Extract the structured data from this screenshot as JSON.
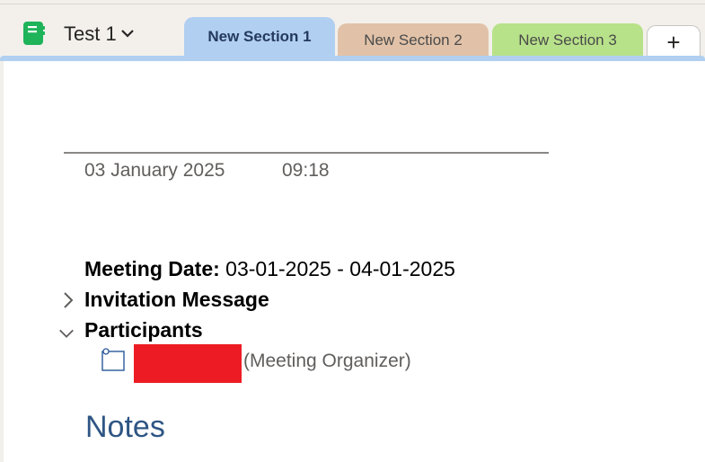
{
  "notebook": {
    "name": "Test 1",
    "icon": "notebook-icon",
    "icon_color": "#1fb35a"
  },
  "tabs": [
    {
      "label": "New Section 1",
      "color": "#b1cff0",
      "active": true
    },
    {
      "label": "New Section 2",
      "color": "#e1c2a8",
      "active": false
    },
    {
      "label": "New Section 3",
      "color": "#b8e28a",
      "active": false
    }
  ],
  "add_tab_label": "+",
  "page": {
    "date": "03 January 2025",
    "time": "09:18",
    "meeting_date_label": "Meeting Date:",
    "meeting_date_value": " 03-01-2025 - 04-01-2025",
    "invitation_label": "Invitation Message",
    "participants_label": "Participants",
    "participant_role": "(Meeting Organizer)",
    "notes_heading": "Notes"
  }
}
